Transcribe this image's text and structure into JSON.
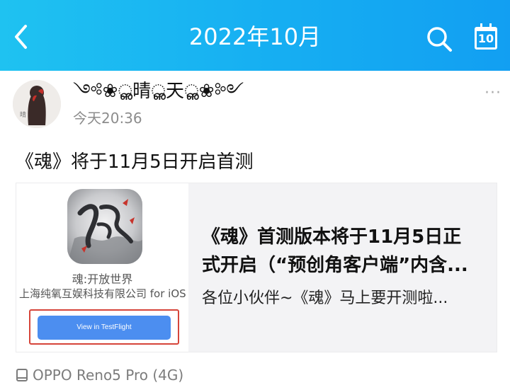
{
  "header": {
    "title": "2022年10月",
    "calendar_day": "10",
    "icons": {
      "back": "chevron-left-icon",
      "search": "search-icon",
      "calendar": "calendar-icon"
    },
    "colors": {
      "bar_start": "#1fc2f1",
      "bar_end": "#129ff2"
    }
  },
  "post": {
    "author": "༺❀ൢ晴ൢ天ൢ❀༻",
    "time": "今天20:36",
    "more": "···",
    "text": "《魂》将于11月5日开启首测",
    "device": "OPPO Reno5 Pro (4G)"
  },
  "link_card": {
    "app_name": "魂:开放世界",
    "company": "上海纯氧互娱科技有限公司 for iOS",
    "button_label": "View in TestFlight",
    "title_line1": "《魂》首测版本将于11月5日正",
    "title_line2": "式开启（“预创角客户端”内含...",
    "description": "各位小伙伴~《魂》马上要开测啦..."
  }
}
